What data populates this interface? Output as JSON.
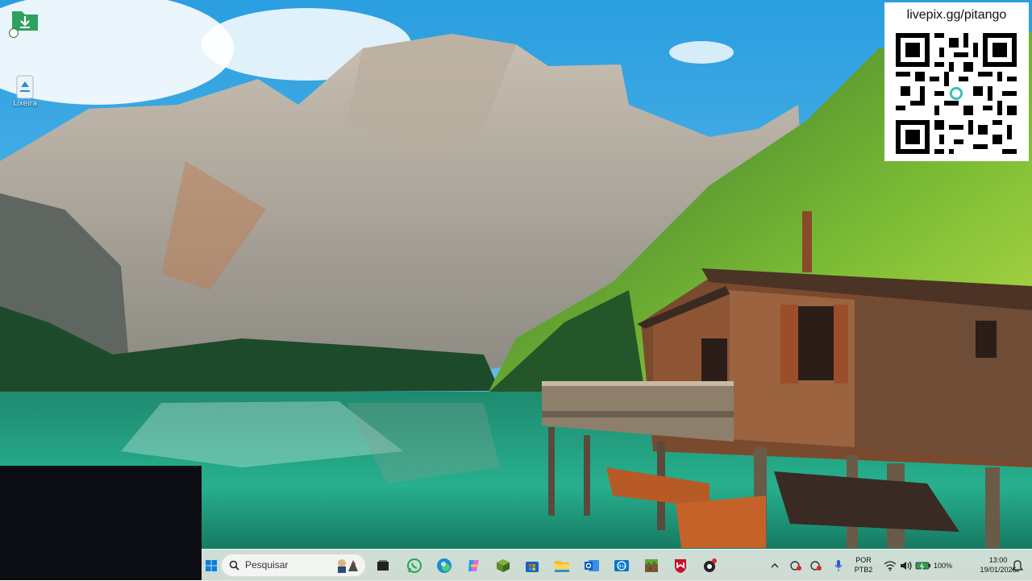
{
  "desktop": {
    "icons": [
      {
        "name": "download-folder-icon",
        "label": ""
      },
      {
        "name": "recycle-bin-icon",
        "label": "Lixeira"
      }
    ]
  },
  "qr_panel": {
    "url": "livepix.gg/pitango"
  },
  "taskbar": {
    "search_placeholder": "Pesquisar",
    "apps": [
      "start-icon",
      "search-icon",
      "task-view-icon",
      "whatsapp-icon",
      "edge-icon",
      "copilot-icon",
      "minecraft-launcher-icon",
      "microsoft-store-icon",
      "file-explorer-icon",
      "outlook-icon",
      "dell-icon",
      "minecraft-icon",
      "mcafee-icon",
      "recording-icon"
    ],
    "tray": {
      "language": "POR",
      "layout": "PTB2",
      "battery": "100%",
      "time": "13:00",
      "date": "19/01/2026"
    }
  },
  "colors": {
    "taskbar_bg": "#dee6e0",
    "overlay_box": "#0b0d12",
    "accent": "#0067c0"
  }
}
